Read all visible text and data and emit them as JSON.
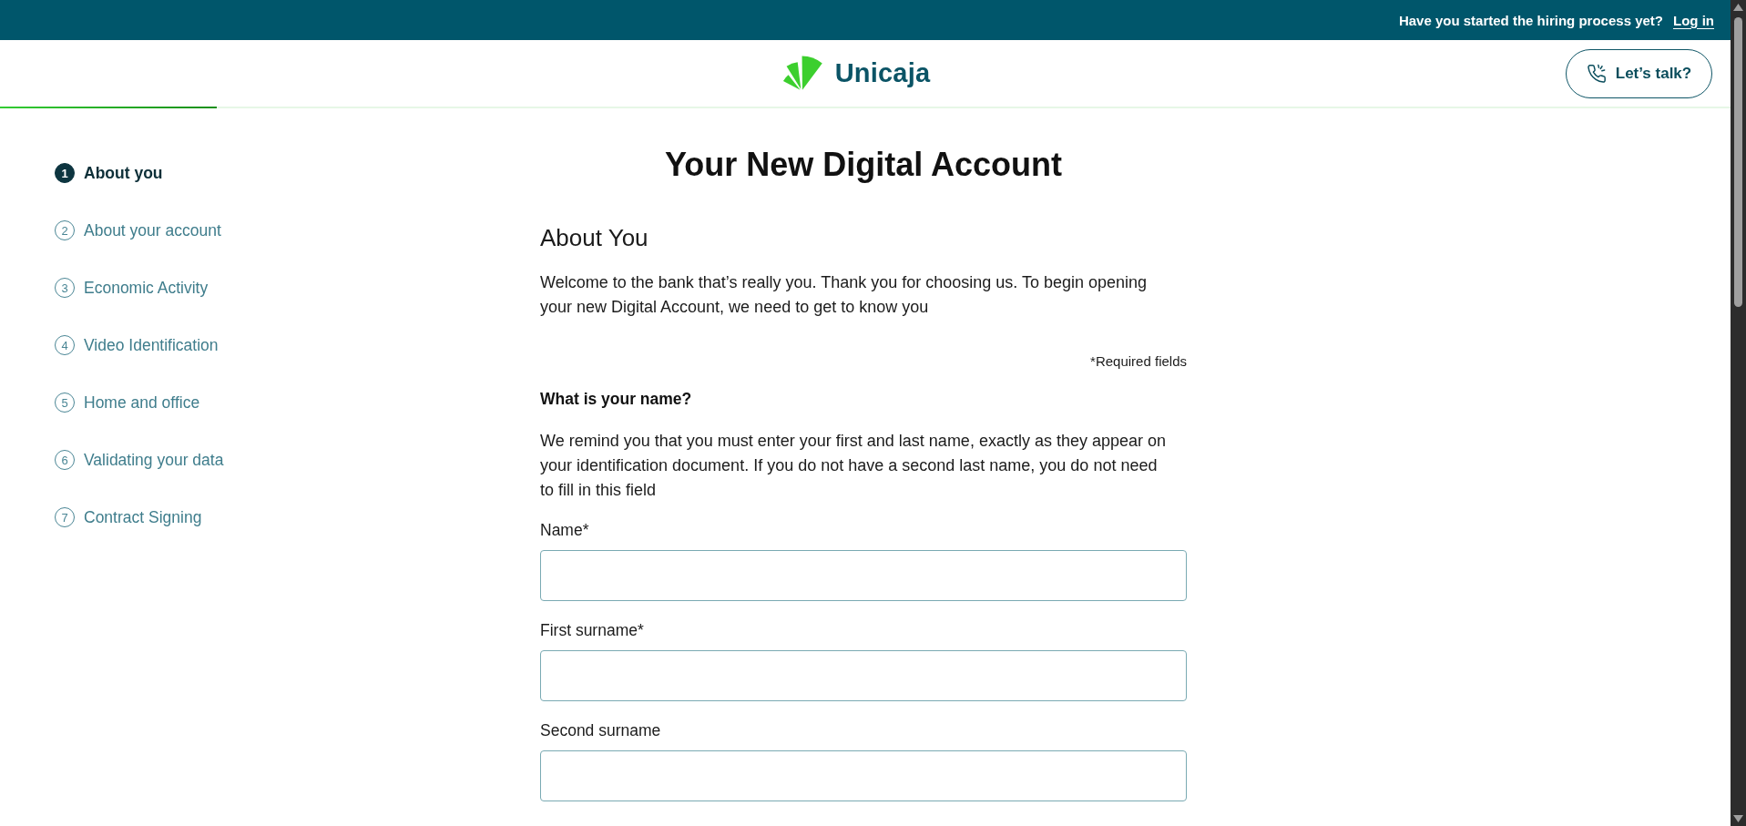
{
  "top_bar": {
    "question": "Have you started the hiring process yet?",
    "login_link": "Log in"
  },
  "header": {
    "logo_text": "Unicaja",
    "talk_button": "Let’s talk?",
    "progress": {
      "level": 0.125
    }
  },
  "steps": [
    {
      "number": "1",
      "label": "About you",
      "selected": true
    },
    {
      "number": "2",
      "label": "About your account",
      "selected": false
    },
    {
      "number": "3",
      "label": "Economic Activity",
      "selected": false
    },
    {
      "number": "4",
      "label": "Video Identification",
      "selected": false
    },
    {
      "number": "5",
      "label": "Home and office",
      "selected": false
    },
    {
      "number": "6",
      "label": "Validating your data",
      "selected": false
    },
    {
      "number": "7",
      "label": "Contract Signing",
      "selected": false
    }
  ],
  "main": {
    "title": "Your New Digital Account",
    "section_title": "About You",
    "intro": "Welcome to the bank that’s really you. Thank you for choosing us. To begin opening your new Digital Account, we need to get to know you",
    "required_note": "*Required fields",
    "question": "What is your name?",
    "hint": "We remind you that you must enter your first and last name, exactly as they appear on your identification document. If you do not have a second last name, you do not need to fill in this field",
    "fields": [
      {
        "label": "Name*"
      },
      {
        "label": "First surname*"
      },
      {
        "label": "Second surname"
      }
    ]
  }
}
